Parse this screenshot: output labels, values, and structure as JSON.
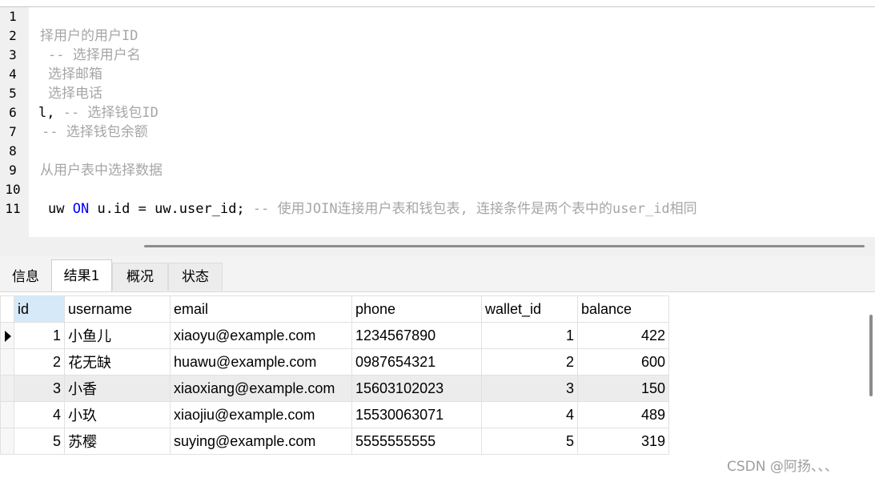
{
  "editor": {
    "lines": [
      {
        "num": "1",
        "pre": "",
        "cm": "",
        "kw": "",
        "post": ""
      },
      {
        "num": "2",
        "pre": "",
        "cm": "择用户的用户ID",
        "kw": "",
        "post": ""
      },
      {
        "num": "3",
        "pre": "",
        "cm": "-- 选择用户名",
        "kw": "",
        "post": ""
      },
      {
        "num": "4",
        "pre": "",
        "cm": "选择邮箱",
        "kw": "",
        "post": ""
      },
      {
        "num": "5",
        "pre": "",
        "cm": "选择电话",
        "kw": "",
        "post": ""
      },
      {
        "num": "6",
        "pre": "l, ",
        "cm": "-- 选择钱包ID",
        "kw": "",
        "post": ""
      },
      {
        "num": "7",
        "pre": "",
        "cm": "-- 选择钱包余额",
        "kw": "",
        "post": ""
      },
      {
        "num": "8",
        "pre": "",
        "cm": "",
        "kw": "",
        "post": ""
      },
      {
        "num": "9",
        "pre": "",
        "cm": "从用户表中选择数据",
        "kw": "",
        "post": ""
      },
      {
        "num": "10",
        "pre": "",
        "cm": "",
        "kw": "",
        "post": ""
      },
      {
        "num": "11",
        "pre": "uw ",
        "kw": "ON",
        "post": " u.id = uw.user_id; ",
        "cm": "-- 使用JOIN连接用户表和钱包表, 连接条件是两个表中的user_id相同"
      }
    ]
  },
  "tabs": [
    {
      "label": "信息",
      "active": false
    },
    {
      "label": "结果1",
      "active": true
    },
    {
      "label": "概况",
      "active": false
    },
    {
      "label": "状态",
      "active": false
    }
  ],
  "grid": {
    "columns": [
      "id",
      "username",
      "email",
      "phone",
      "wallet_id",
      "balance"
    ],
    "rows": [
      [
        "1",
        "小鱼儿",
        "xiaoyu@example.com",
        "1234567890",
        "1",
        "422"
      ],
      [
        "2",
        "花无缺",
        "huawu@example.com",
        "0987654321",
        "2",
        "600"
      ],
      [
        "3",
        "小香",
        "xiaoxiang@example.com",
        "15603102023",
        "3",
        "150"
      ],
      [
        "4",
        "小玖",
        "xiaojiu@example.com",
        "15530063071",
        "4",
        "489"
      ],
      [
        "5",
        "苏樱",
        "suying@example.com",
        "5555555555",
        "5",
        "319"
      ]
    ],
    "current_row_index": 0,
    "highlighted_row_index": 2
  },
  "watermark": "CSDN @阿扬、、、"
}
